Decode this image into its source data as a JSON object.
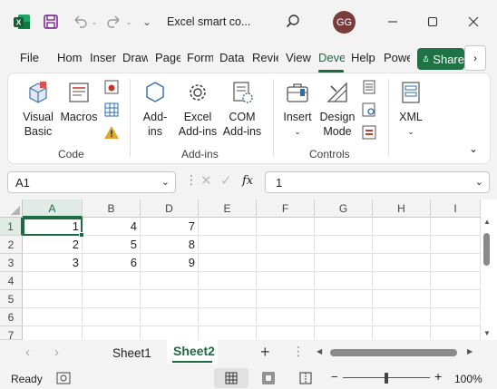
{
  "window": {
    "title": "Excel smart co...",
    "avatar_initials": "GG"
  },
  "ribbon_tabs": [
    "File",
    "Hom",
    "Inser",
    "Draw",
    "Page",
    "Form",
    "Data",
    "Revie",
    "View",
    "Deve",
    "Help",
    "Powe"
  ],
  "active_tab": "Deve",
  "share_label": "Share",
  "ribbon": {
    "code": {
      "label": "Code",
      "visual_basic": "Visual Basic",
      "visual_basic_l1": "Visual",
      "visual_basic_l2": "Basic",
      "macros": "Macros"
    },
    "addins": {
      "label": "Add-ins",
      "addins_l1": "Add-",
      "addins_l2": "ins",
      "excel_l1": "Excel",
      "excel_l2": "Add-ins",
      "com_l1": "COM",
      "com_l2": "Add-ins"
    },
    "controls": {
      "label": "Controls",
      "insert": "Insert",
      "design_l1": "Design",
      "design_l2": "Mode"
    },
    "xml": {
      "label": "XML"
    }
  },
  "formula_bar": {
    "name_box": "A1",
    "fx": "fx",
    "value": "1"
  },
  "grid": {
    "columns": [
      "A",
      "B",
      "D",
      "E",
      "F",
      "G",
      "H",
      "I"
    ],
    "rows": [
      "1",
      "2",
      "3",
      "4",
      "5",
      "6",
      "7"
    ],
    "cells": [
      [
        "1",
        "4",
        "7"
      ],
      [
        "2",
        "5",
        "8"
      ],
      [
        "3",
        "6",
        "9"
      ]
    ],
    "selected_cell": "A1"
  },
  "sheets": [
    "Sheet1",
    "Sheet2"
  ],
  "active_sheet": "Sheet2",
  "status": {
    "ready": "Ready",
    "zoom": "100%",
    "zoom_fraction": 0.5
  },
  "colors": {
    "accent": "#1e6b41",
    "share_bg": "#1f7244",
    "avatar_bg": "#7a3b3b"
  },
  "icons": {
    "app": "excel-logo-icon",
    "save": "save-icon",
    "undo": "undo-icon",
    "redo": "redo-icon",
    "search": "search-icon",
    "minimize": "minimize-icon",
    "maximize": "maximize-icon",
    "close": "close-icon"
  }
}
